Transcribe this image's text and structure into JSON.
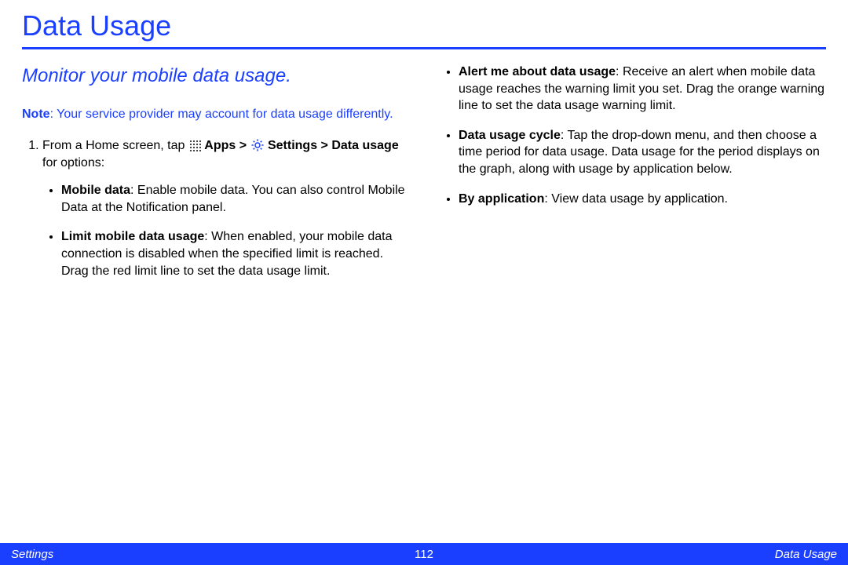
{
  "title": "Data Usage",
  "subtitle": "Monitor your mobile data usage.",
  "note": {
    "label": "Note",
    "text": ": Your service provider may account for data usage differently."
  },
  "step": {
    "prefix": "From a Home screen, tap ",
    "apps": "Apps",
    "gt1": " > ",
    "settings": "Settings",
    "gt2": " > ",
    "data_usage": "Data usage",
    "suffix": " for options:"
  },
  "left_bullets": [
    {
      "term": "Mobile data",
      "desc": ": Enable mobile data. You can also control Mobile Data at the Notification panel."
    },
    {
      "term": "Limit mobile data usage",
      "desc": ": When enabled, your mobile data connection is disabled when the specified limit is reached. Drag the red limit line to set the data usage limit."
    }
  ],
  "right_bullets": [
    {
      "term": "Alert me about data usage",
      "desc": ": Receive an alert when mobile data usage reaches the warning limit you set. Drag the orange warning line to set the data usage warning limit."
    },
    {
      "term": "Data usage cycle",
      "desc": ": Tap the drop-down menu, and then choose a time period for data usage. Data usage for the period displays on the graph, along with usage by application below."
    },
    {
      "term": "By application",
      "desc": ": View data usage by application."
    }
  ],
  "footer": {
    "left": "Settings",
    "center": "112",
    "right": "Data Usage"
  }
}
